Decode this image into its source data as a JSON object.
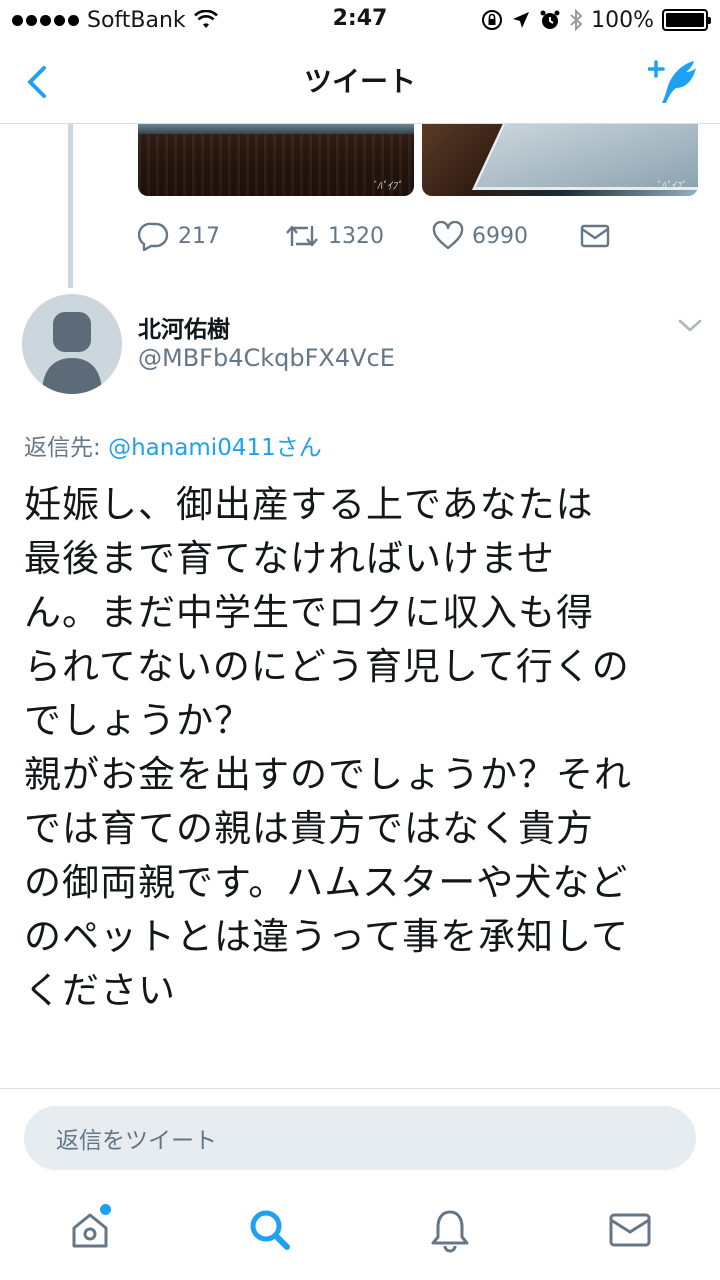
{
  "status_bar": {
    "carrier": "SoftBank",
    "time": "2:47",
    "battery": "100%",
    "battery_level": 1.0
  },
  "nav": {
    "title": "ツイート"
  },
  "parent_tweet": {
    "reply_count": "217",
    "retweet_count": "1320",
    "like_count": "6990"
  },
  "tweet": {
    "author_name": "北河佑樹",
    "author_handle": "@MBFb4CkqbFX4VcE",
    "reply_prefix": "返信先: ",
    "reply_mention": "@hanami0411さん",
    "text": "妊娠し、御出産する上であなたは\n最後まで育てなければいけませ\nん。まだ中学生でロクに収入も得\nられてないのにどう育児して行くの\nでしょうか？\n親がお金を出すのでしょうか？それ\nでは育ての親は貴方ではなく貴方\nの御両親です。ハムスターや犬など\nのペットとは違うって事を承知して\nください"
  },
  "reply_box": {
    "placeholder": "返信をツイート"
  },
  "colors": {
    "accent": "#1da1f2",
    "secondary_text": "#657786",
    "primary_text": "#14171a",
    "divider": "#d7dde2"
  },
  "icons": [
    "back-chevron-icon",
    "compose-tweet-icon",
    "reply-icon",
    "retweet-icon",
    "like-heart-icon",
    "direct-message-icon",
    "chevron-down-icon",
    "home-icon",
    "search-icon",
    "notifications-bell-icon",
    "messages-envelope-icon"
  ]
}
